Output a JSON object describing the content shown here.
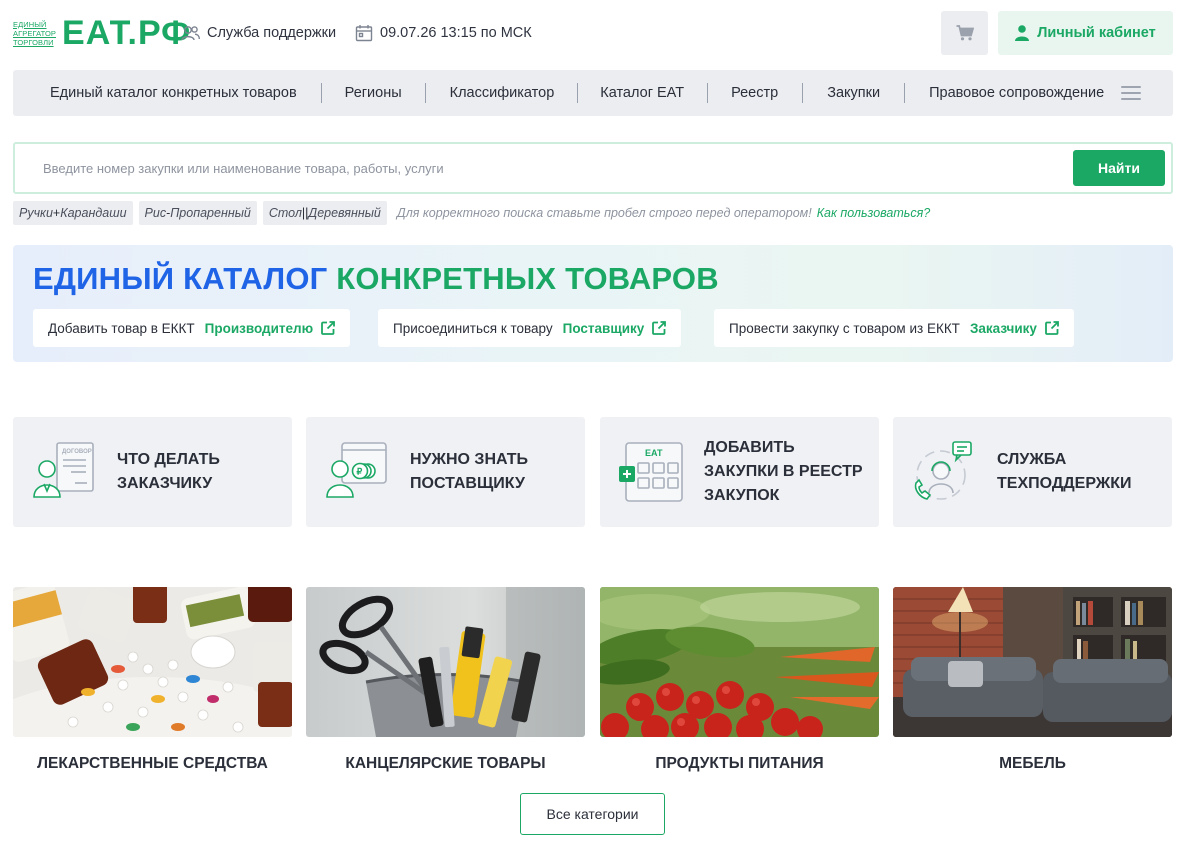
{
  "header": {
    "logo_small_lines": [
      "ЕДИНЫЙ",
      "АГРЕГАТОР",
      "ТОРГОВЛИ"
    ],
    "logo_big": "ЕАТ.РФ",
    "support_label": "Служба поддержки",
    "datetime": "09.07.26 13:15 по МСК",
    "cabinet_label": "Личный кабинет",
    "support_icon": "users-icon",
    "calendar_icon": "calendar-icon",
    "cart_icon": "cart-icon",
    "user_icon": "user-icon"
  },
  "nav": {
    "items": [
      "Единый каталог конкретных товаров",
      "Регионы",
      "Классификатор",
      "Каталог ЕАТ",
      "Реестр",
      "Закупки",
      "Правовое сопровождение"
    ],
    "menu_icon": "hamburger-icon"
  },
  "search": {
    "placeholder": "Введите номер закупки или наименование товара, работы, услуги",
    "value": "",
    "button_label": "Найти"
  },
  "hints": {
    "examples": [
      {
        "left": "Ручки",
        "op": "+",
        "right": "Карандаши"
      },
      {
        "left": "Рис",
        "op": "-",
        "right": "Пропаренный"
      },
      {
        "left": "Стол",
        "op": "||",
        "right": "Деревянный"
      }
    ],
    "note": "Для корректного поиска ставьте пробел строго перед оператором!",
    "link": "Как пользоваться?"
  },
  "banner": {
    "title_part1": "ЕДИНЫЙ КАТАЛОГ",
    "title_part2": "КОНКРЕТНЫХ ТОВАРОВ",
    "cards": [
      {
        "text": "Добавить товар в ЕККТ",
        "link": "Производителю"
      },
      {
        "text": "Присоединиться к товару",
        "link": "Поставщику"
      },
      {
        "text": "Провести закупку с товаром из ЕККТ",
        "link": "Заказчику"
      }
    ],
    "external_icon": "external-link-icon"
  },
  "info_cards": [
    {
      "lines": [
        "ЧТО ДЕЛАТЬ",
        "ЗАКАЗЧИКУ"
      ],
      "icon": "contract-person-icon"
    },
    {
      "lines": [
        "НУЖНО ЗНАТЬ",
        "ПОСТАВЩИКУ"
      ],
      "icon": "supplier-coins-icon"
    },
    {
      "lines": [
        "ДОБАВИТЬ",
        "ЗАКУПКИ В РЕЕСТР",
        "ЗАКУПОК"
      ],
      "icon": "registry-add-icon"
    },
    {
      "lines": [
        "СЛУЖБА",
        "ТЕХПОДДЕРЖКИ"
      ],
      "icon": "support-agent-icon"
    }
  ],
  "categories": [
    {
      "label": "ЛЕКАРСТВЕННЫЕ СРЕДСТВА",
      "image": "medicines-photo"
    },
    {
      "label": "КАНЦЕЛЯРСКИЕ ТОВАРЫ",
      "image": "stationery-photo"
    },
    {
      "label": "ПРОДУКТЫ ПИТАНИЯ",
      "image": "vegetables-photo"
    },
    {
      "label": "МЕБЕЛЬ",
      "image": "furniture-photo"
    }
  ],
  "all_categories_label": "Все категории",
  "colors": {
    "brand_green": "#1ba865",
    "brand_blue": "#1f64e6",
    "panel_gray": "#ecedf1"
  }
}
